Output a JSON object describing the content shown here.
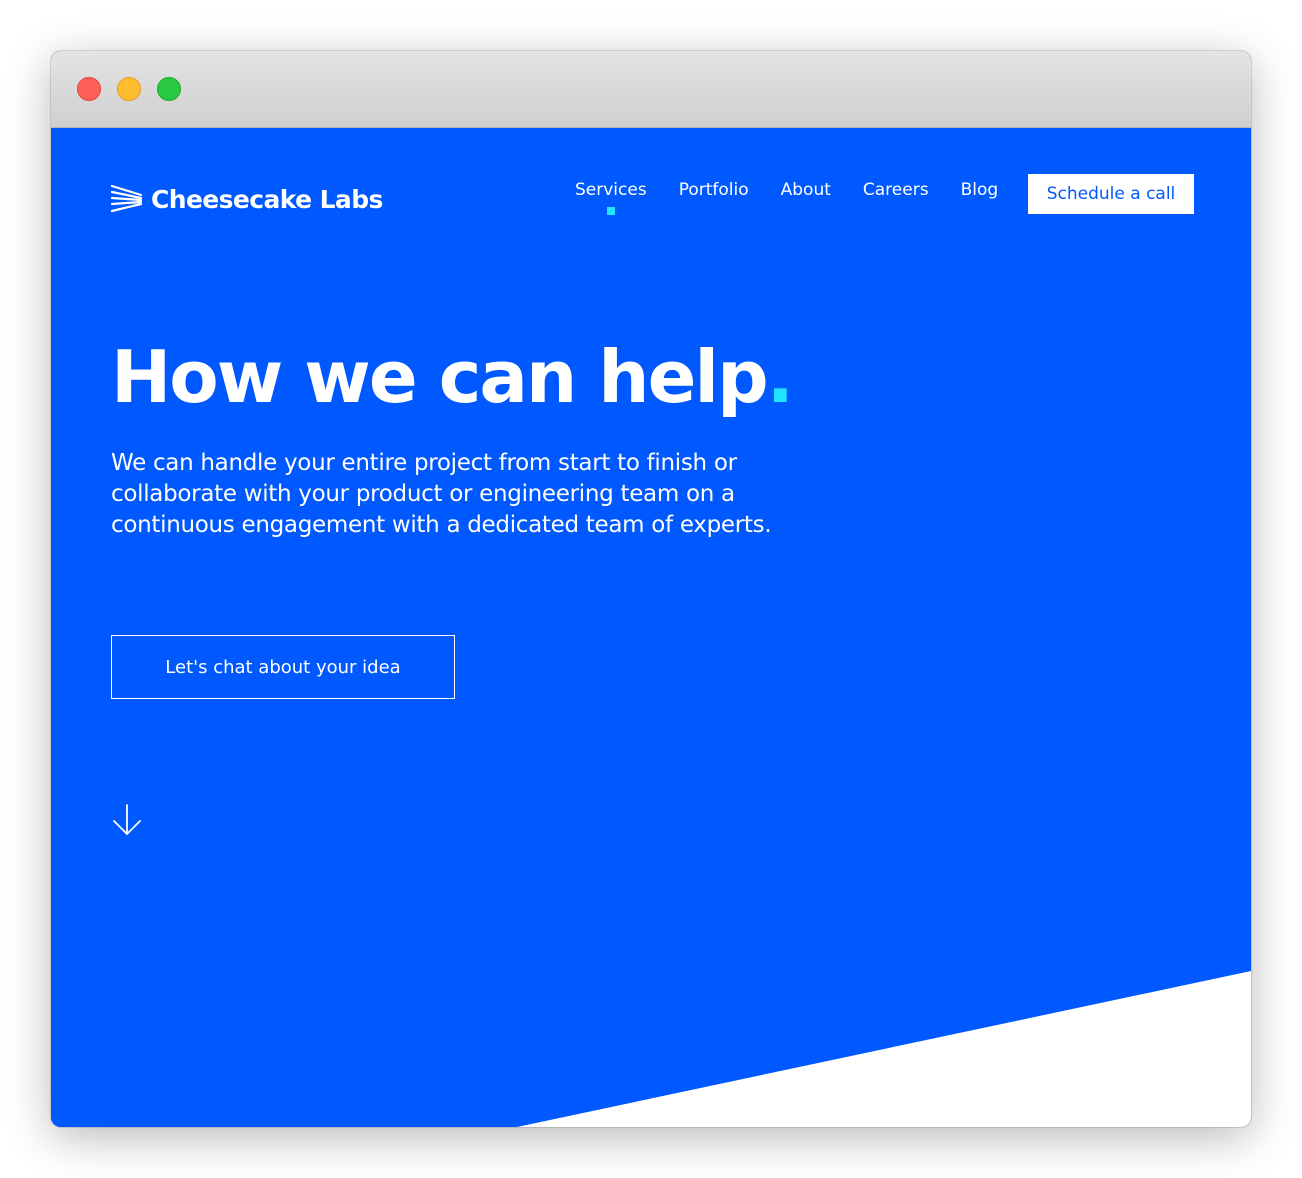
{
  "brand": {
    "name": "Cheesecake Labs",
    "logo_icon": "stripes-logo-icon"
  },
  "nav": {
    "items": [
      {
        "label": "Services",
        "active": true
      },
      {
        "label": "Portfolio",
        "active": false
      },
      {
        "label": "About",
        "active": false
      },
      {
        "label": "Careers",
        "active": false
      },
      {
        "label": "Blog",
        "active": false
      }
    ],
    "cta_label": "Schedule a call"
  },
  "hero": {
    "title": "How we can help",
    "title_accent": ".",
    "description": "We can handle your entire project from start to finish or collaborate with your product or engineering team on a continuous engagement with a dedicated team of experts.",
    "button_label": "Let's chat about your idea",
    "scroll_icon": "arrow-down-icon"
  },
  "colors": {
    "primary_blue": "#0058ff",
    "accent_cyan": "#1fe3ff",
    "white": "#ffffff"
  }
}
